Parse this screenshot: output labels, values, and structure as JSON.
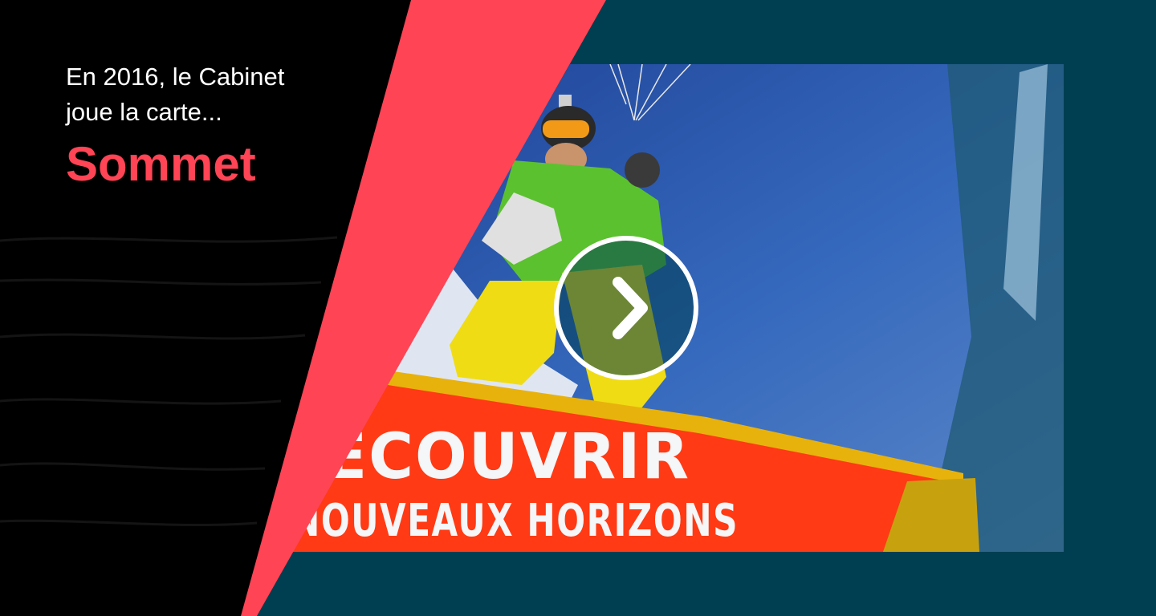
{
  "intro": {
    "line1": "En 2016, le Cabinet",
    "line2": "joue la carte..."
  },
  "headline": "Sommet",
  "video": {
    "caption_line1": "DÉCOUVRIR",
    "caption_line2": "DE NOUVEAUX HORIZONS",
    "play_icon": "chevron-right-icon"
  },
  "colors": {
    "background_left": "#000000",
    "background_right": "#003f52",
    "accent": "#ff4455",
    "headline": "#ff4455",
    "banner": "#ff3a14",
    "sky": "#2f5fb0"
  }
}
